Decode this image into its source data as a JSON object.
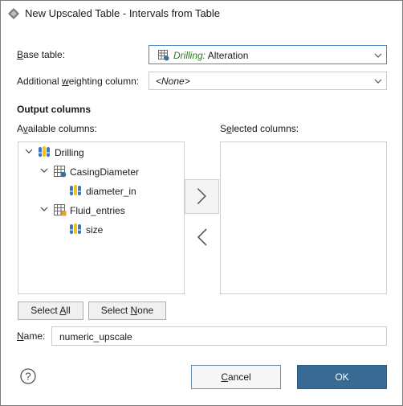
{
  "window": {
    "title": "New Upscaled Table - Intervals from Table"
  },
  "base_table": {
    "label": "Base table:",
    "value_prefix": "Drilling:",
    "value": "Alteration"
  },
  "weighting": {
    "label_pre": "Additional ",
    "label_key": "w",
    "label_post": "eighting column:",
    "value": "<None>"
  },
  "output_columns": {
    "title": "Output columns",
    "available_label": "Available columns:",
    "selected_label": "Selected columns:",
    "tree": [
      {
        "label": "Drilling"
      },
      {
        "label": "CasingDiameter"
      },
      {
        "label": "diameter_in"
      },
      {
        "label": "Fluid_entries"
      },
      {
        "label": "size"
      }
    ],
    "selected": []
  },
  "buttons": {
    "select_all": "Select All",
    "select_none": "Select None",
    "cancel": "Cancel",
    "ok": "OK"
  },
  "name_field": {
    "label": "Name:",
    "value": "numeric_upscale"
  },
  "colors": {
    "accent": "#386a93",
    "focus_border": "#4a86c8",
    "table_prefix_green": "#2b7a1f"
  }
}
